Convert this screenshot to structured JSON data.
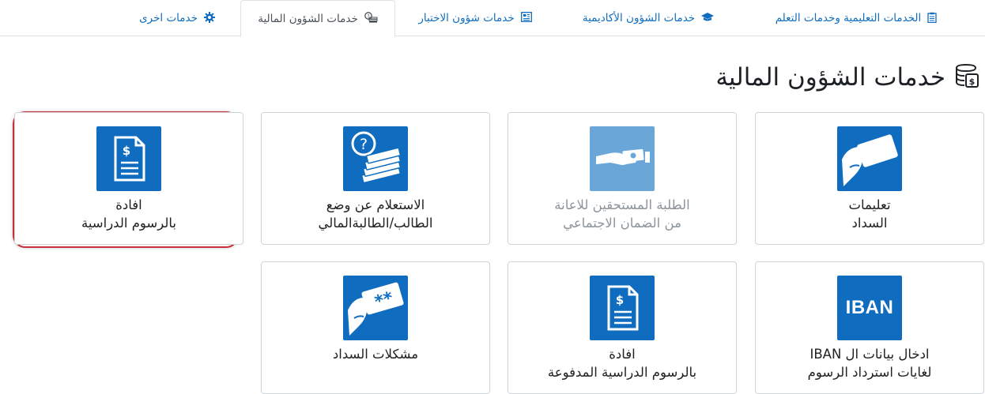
{
  "tabs": [
    {
      "label": "الخدمات التعليمية وخدمات التعلم",
      "icon": "clipboard-icon",
      "active": false
    },
    {
      "label": "خدمات الشؤون الأكاديمية",
      "icon": "graduation-cap-icon",
      "active": false
    },
    {
      "label": "خدمات شؤون الاختبار",
      "icon": "newspaper-icon",
      "active": false
    },
    {
      "label": "خدمات الشؤون المالية",
      "icon": "money-stack-icon",
      "active": true
    },
    {
      "label": "خدمات اخرى",
      "icon": "gear-icon",
      "active": false
    }
  ],
  "page": {
    "title": "خدمات الشؤون المالية",
    "title_icon": "money-stack-icon"
  },
  "cards": [
    {
      "line1": "تعليمات",
      "line2": "السداد",
      "icon": "hand-card-icon",
      "disabled": false
    },
    {
      "line1": "الطلبة المستحقين للاعانة",
      "line2": "من الضمان الاجتماعي",
      "icon": "hand-giving-money-icon",
      "disabled": true
    },
    {
      "line1": "الاستعلام عن وضع",
      "line2": "الطالب/الطالبةالمالي",
      "icon": "money-question-icon",
      "disabled": false
    },
    {
      "line1": "افادة",
      "line2": "بالرسوم الدراسية",
      "icon": "dollar-document-icon",
      "disabled": false,
      "highlighted": true
    },
    {
      "line1": "ادخال بيانات ال IBAN",
      "line2": "لغايات استرداد الرسوم",
      "icon": "iban-icon",
      "icon_text": "IBAN",
      "disabled": false
    },
    {
      "line1": "افادة",
      "line2": "بالرسوم الدراسية المدفوعة",
      "icon": "dollar-document-icon",
      "disabled": false
    },
    {
      "line1": "مشكلات السداد",
      "line2": "",
      "icon": "hand-card-stars-icon",
      "icon_text": "**",
      "disabled": false
    }
  ],
  "colors": {
    "accent": "#0f6cbf",
    "accent_disabled": "#6aa7d8",
    "highlight": "#c6303a"
  }
}
